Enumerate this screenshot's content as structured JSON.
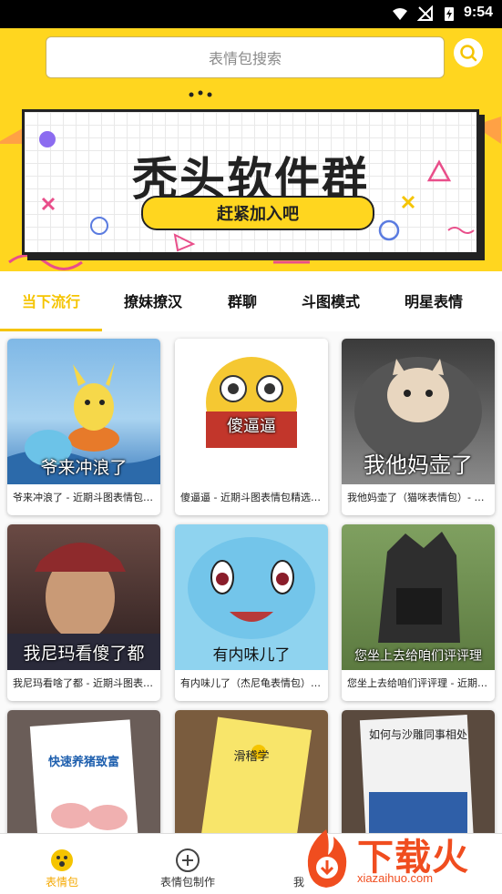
{
  "status_bar": {
    "time": "9:54"
  },
  "search": {
    "placeholder": "表情包搜索"
  },
  "banner": {
    "title": "秃头软件群",
    "button_label": "赶紧加入吧"
  },
  "tabs": [
    {
      "label": "当下流行",
      "active": true
    },
    {
      "label": "撩妹撩汉",
      "active": false
    },
    {
      "label": "群聊",
      "active": false
    },
    {
      "label": "斗图模式",
      "active": false
    },
    {
      "label": "明星表情",
      "active": false
    }
  ],
  "cards": [
    {
      "overlay": "爷来冲浪了",
      "caption": "爷来冲浪了 - 近期斗图表情包精..."
    },
    {
      "overlay": "傻逼逼",
      "caption": "傻逼逼 - 近期斗图表情包精选-201..."
    },
    {
      "overlay": "我他妈壶了",
      "caption": "我他妈壶了（猫咪表情包）- 近..."
    },
    {
      "overlay": "我尼玛看傻了都",
      "caption": "我尼玛看啥了都 - 近期斗图表情..."
    },
    {
      "overlay": "有内味儿了",
      "caption": "有内味儿了（杰尼龟表情包）- ..."
    },
    {
      "overlay": "您坐上去给咱们评评理",
      "caption": "您坐上去给咱们评评理 - 近期斗..."
    },
    {
      "overlay": "快速养猪致富",
      "caption": ""
    },
    {
      "overlay": "滑稽学",
      "caption": ""
    },
    {
      "overlay": "如何与沙雕同事相处",
      "caption": ""
    }
  ],
  "bottom_nav": [
    {
      "label": "表情包",
      "active": true
    },
    {
      "label": "表情包制作",
      "active": false
    },
    {
      "label": "我",
      "active": false
    }
  ],
  "watermark": {
    "brand": "下载火",
    "url": "xiazaihuo.com"
  },
  "colors": {
    "accent": "#ffd61f",
    "active_tab": "#f5c400",
    "watermark": "#f04d1f"
  }
}
